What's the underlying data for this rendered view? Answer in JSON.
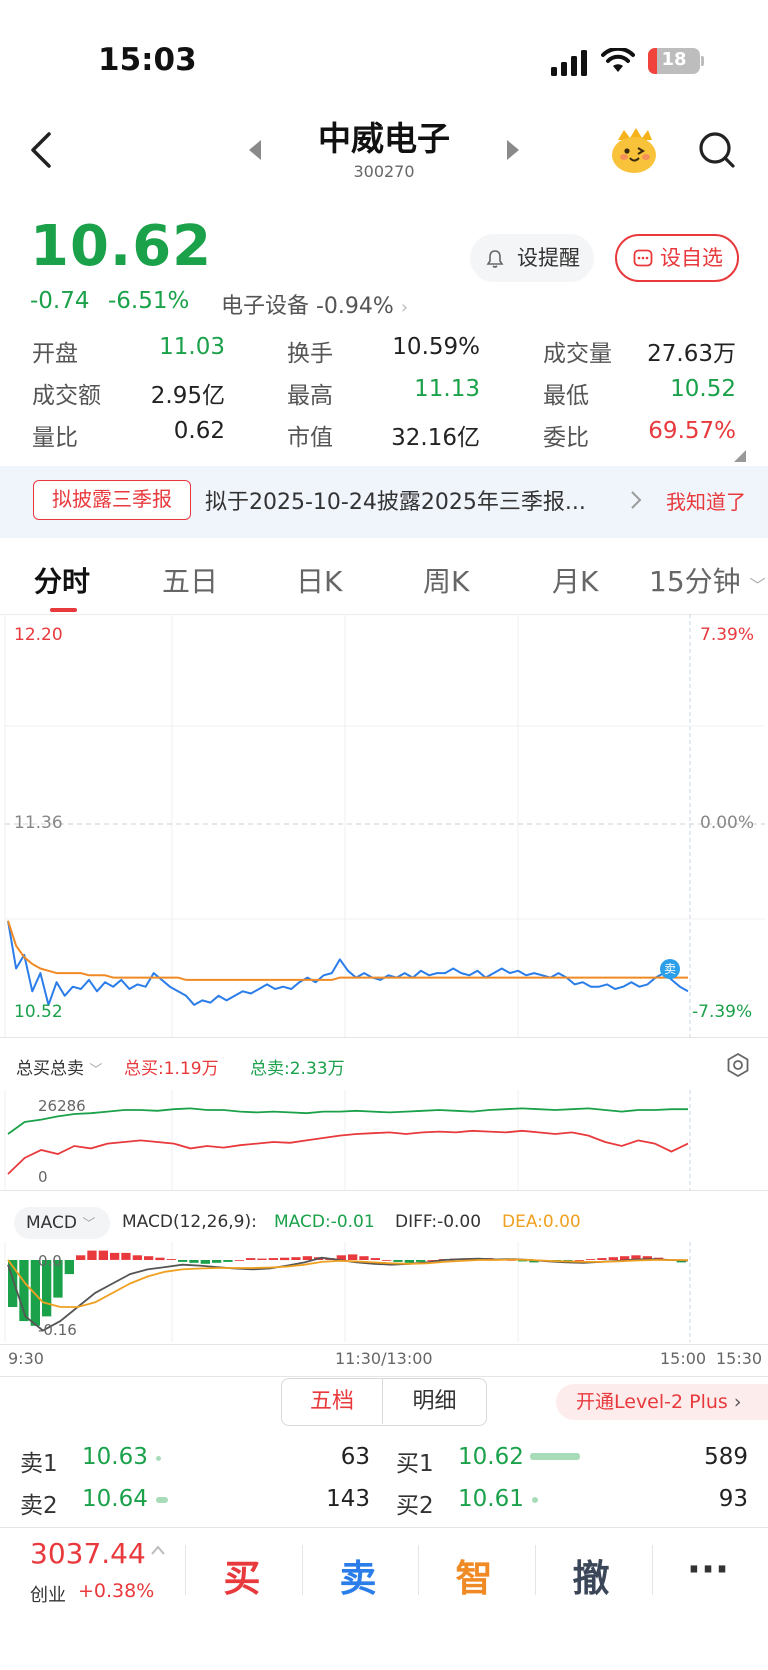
{
  "status_bar": {
    "time": "15:03",
    "battery": "18"
  },
  "header": {
    "title": "中威电子",
    "code": "300270"
  },
  "quote": {
    "price": "10.62",
    "change": "-0.74",
    "change_pct": "-6.51%",
    "sector": "电子设备 -0.94%",
    "remind_label": "设提醒",
    "add_label": "设自选"
  },
  "stats": [
    [
      {
        "label": "开盘",
        "value": "11.03",
        "color": "#1aa14a"
      },
      {
        "label": "换手",
        "value": "10.59%",
        "color": "#222222"
      },
      {
        "label": "成交量",
        "value": "27.63万",
        "color": "#222222"
      }
    ],
    [
      {
        "label": "成交额",
        "value": "2.95亿",
        "color": "#222222"
      },
      {
        "label": "最高",
        "value": "11.13",
        "color": "#1aa14a"
      },
      {
        "label": "最低",
        "value": "10.52",
        "color": "#1aa14a"
      }
    ],
    [
      {
        "label": "量比",
        "value": "0.62",
        "color": "#222222"
      },
      {
        "label": "市值",
        "value": "32.16亿",
        "color": "#222222"
      },
      {
        "label": "委比",
        "value": "69.57%",
        "color": "#e8393c"
      }
    ]
  ],
  "notice": {
    "tag": "拟披露三季报",
    "text": "拟于2025-10-24披露2025年三季报...",
    "ack": "我知道了"
  },
  "tabs": [
    "分时",
    "五日",
    "日K",
    "周K",
    "月K",
    "15分钟"
  ],
  "colors": {
    "up": "#e8393c",
    "down": "#1aa14a",
    "price_line": "#2b7de9",
    "avg_line": "#f08a24"
  },
  "chart_data": {
    "type": "line",
    "price_axis": {
      "top": "12.20",
      "mid": "11.36",
      "bottom": "10.52"
    },
    "pct_axis": {
      "top": "7.39%",
      "mid": "0.00%",
      "bottom": "-7.39%"
    },
    "ylim": [
      10.52,
      12.2
    ],
    "x_ticks": [
      "9:30",
      "11:30/13:00",
      "15:00",
      "15:30"
    ],
    "sell_marker": "卖",
    "series": [
      {
        "values": [
          10.93,
          10.72,
          10.78,
          10.62,
          10.7,
          10.56,
          10.66,
          10.6,
          10.64,
          10.63,
          10.67,
          10.62,
          10.66,
          10.64,
          10.67,
          10.63,
          10.65,
          10.64,
          10.7,
          10.67,
          10.64,
          10.62,
          10.6,
          10.56,
          10.58,
          10.57,
          10.6,
          10.58,
          10.6,
          10.62,
          10.61,
          10.63,
          10.65,
          10.63,
          10.64,
          10.63,
          10.66,
          10.68,
          10.66,
          10.69,
          10.7,
          10.76,
          10.71,
          10.68,
          10.7,
          10.68,
          10.67,
          10.69,
          10.68,
          10.7,
          10.68,
          10.71,
          10.69,
          10.7,
          10.7,
          10.72,
          10.7,
          10.69,
          10.71,
          10.68,
          10.7,
          10.72,
          10.7,
          10.71,
          10.69,
          10.7,
          10.69,
          10.68,
          10.7,
          10.68,
          10.65,
          10.66,
          10.64,
          10.64,
          10.65,
          10.63,
          10.64,
          10.66,
          10.64,
          10.65,
          10.68,
          10.7,
          10.67,
          10.64,
          10.62
        ]
      },
      {
        "values": [
          10.93,
          10.82,
          10.77,
          10.74,
          10.72,
          10.71,
          10.7,
          10.7,
          10.7,
          10.7,
          10.69,
          10.69,
          10.69,
          10.68,
          10.68,
          10.68,
          10.68,
          10.68,
          10.68,
          10.68,
          10.68,
          10.68,
          10.67,
          10.67,
          10.67,
          10.67,
          10.67,
          10.67,
          10.67,
          10.67,
          10.67,
          10.67,
          10.67,
          10.67,
          10.67,
          10.67,
          10.67,
          10.67,
          10.67,
          10.67,
          10.67,
          10.68,
          10.68,
          10.68,
          10.68,
          10.68,
          10.68,
          10.68,
          10.68,
          10.68,
          10.68,
          10.68,
          10.68,
          10.68,
          10.68,
          10.68,
          10.68,
          10.68,
          10.68,
          10.68,
          10.68,
          10.68,
          10.68,
          10.68,
          10.68,
          10.68,
          10.68,
          10.68,
          10.68,
          10.68,
          10.68,
          10.68,
          10.68,
          10.68,
          10.68,
          10.68,
          10.68,
          10.68,
          10.68,
          10.68,
          10.68,
          10.68,
          10.68,
          10.68,
          10.68
        ]
      }
    ],
    "buy_sell": {
      "selector": "总买总卖",
      "total_buy": "总买:1.19万",
      "total_sell": "总卖:2.33万",
      "y_top": "26286",
      "y_bottom": "0",
      "sell_series": [
        0.6,
        0.75,
        0.78,
        0.82,
        0.85,
        0.86,
        0.88,
        0.9,
        0.9,
        0.89,
        0.91,
        0.92,
        0.9,
        0.9,
        0.88,
        0.87,
        0.88,
        0.87,
        0.86,
        0.88,
        0.88,
        0.89,
        0.88,
        0.87,
        0.88,
        0.89,
        0.9,
        0.89,
        0.88,
        0.9,
        0.91,
        0.92,
        0.91,
        0.9,
        0.91,
        0.92,
        0.9,
        0.88,
        0.9,
        0.9,
        0.91,
        0.91
      ],
      "buy_series": [
        0.1,
        0.3,
        0.4,
        0.35,
        0.45,
        0.42,
        0.48,
        0.5,
        0.52,
        0.5,
        0.48,
        0.42,
        0.45,
        0.43,
        0.46,
        0.48,
        0.5,
        0.49,
        0.52,
        0.55,
        0.58,
        0.6,
        0.61,
        0.62,
        0.6,
        0.62,
        0.63,
        0.62,
        0.64,
        0.63,
        0.62,
        0.64,
        0.62,
        0.6,
        0.62,
        0.58,
        0.5,
        0.45,
        0.52,
        0.48,
        0.38,
        0.48
      ]
    },
    "macd": {
      "selector": "MACD",
      "params": "MACD(12,26,9):",
      "macd": "MACD:-0.01",
      "diff": "DIFF:-0.00",
      "dea": "DEA:0.00",
      "y_top": "0.0",
      "y_bottom": "-0.16",
      "bars": [
        -0.1,
        -0.13,
        -0.14,
        -0.12,
        -0.08,
        -0.03,
        0.01,
        0.02,
        0.02,
        0.015,
        0.015,
        0.01,
        0.008,
        0.005,
        0.002,
        -0.004,
        -0.006,
        -0.008,
        -0.006,
        -0.004,
        0.0,
        0.004,
        0.003,
        0.004,
        0.005,
        0.006,
        0.008,
        0.006,
        0.004,
        0.01,
        0.012,
        0.008,
        0.004,
        0.0,
        -0.004,
        -0.006,
        -0.004,
        0.0,
        0.002,
        0.003,
        0.002,
        0.003,
        0.004,
        0.002,
        0.0,
        -0.003,
        -0.005,
        -0.003,
        -0.002,
        -0.001,
        0.0,
        0.002,
        0.004,
        0.006,
        0.008,
        0.01,
        0.008,
        0.005,
        0.0,
        -0.005
      ],
      "diff_series": [
        -0.01,
        -0.12,
        -0.15,
        -0.13,
        -0.1,
        -0.07,
        -0.05,
        -0.03,
        -0.02,
        -0.015,
        -0.01,
        -0.012,
        -0.015,
        -0.018,
        -0.02,
        -0.018,
        -0.012,
        -0.005,
        0.005,
        0.0,
        -0.005,
        -0.008,
        -0.01,
        -0.008,
        -0.005,
        0.0,
        0.002,
        0.003,
        0.001,
        0.002,
        0.0,
        -0.003,
        -0.005,
        -0.006,
        -0.004,
        -0.002,
        0.001,
        0.002,
        0.0,
        -0.001
      ],
      "dea_series": [
        0.0,
        -0.05,
        -0.09,
        -0.1,
        -0.1,
        -0.09,
        -0.07,
        -0.05,
        -0.035,
        -0.025,
        -0.02,
        -0.018,
        -0.017,
        -0.017,
        -0.017,
        -0.016,
        -0.014,
        -0.01,
        -0.004,
        -0.002,
        -0.003,
        -0.005,
        -0.007,
        -0.008,
        -0.007,
        -0.004,
        -0.002,
        0.0,
        0.0,
        0.001,
        0.0,
        -0.002,
        -0.003,
        -0.004,
        -0.004,
        -0.003,
        -0.001,
        0.0,
        0.0,
        0.0
      ]
    }
  },
  "depth": {
    "toggle": [
      "五档",
      "明细"
    ],
    "level2": "开通Level-2 Plus",
    "sell": [
      {
        "label": "卖1",
        "price": "10.63",
        "qty": "63"
      },
      {
        "label": "卖2",
        "price": "10.64",
        "qty": "143"
      }
    ],
    "buy": [
      {
        "label": "买1",
        "price": "10.62",
        "qty": "589",
        "bar": 0.25
      },
      {
        "label": "买2",
        "price": "10.61",
        "qty": "93",
        "bar": 0.02
      }
    ]
  },
  "index": {
    "value": "3037.44",
    "name": "创业",
    "change": "+0.38%"
  },
  "actions": [
    {
      "label": "买",
      "color": "#e8393c"
    },
    {
      "label": "卖",
      "color": "#2b7de9"
    },
    {
      "label": "智",
      "color": "#f08a24"
    },
    {
      "label": "撤",
      "color": "#3b4758"
    },
    {
      "label": "···",
      "color": "#333333"
    }
  ]
}
